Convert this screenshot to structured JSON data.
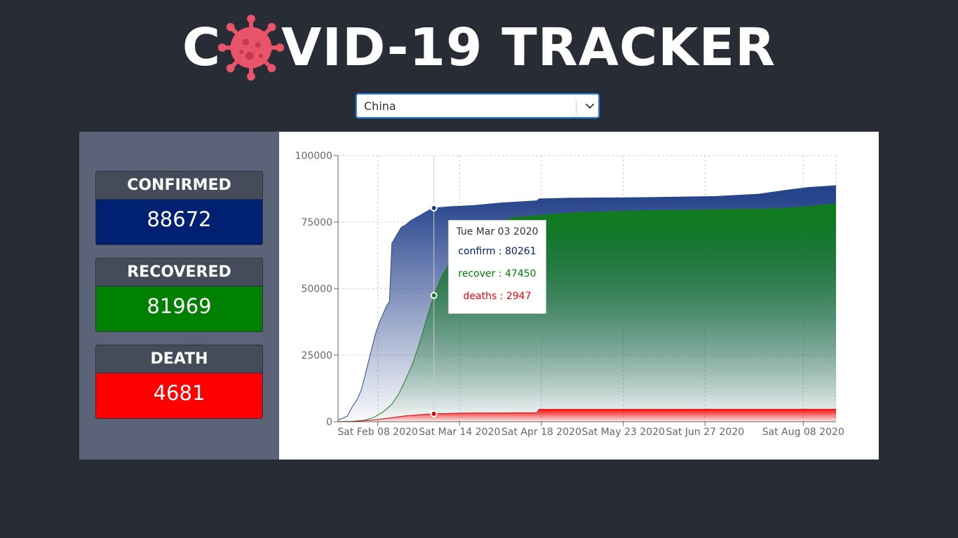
{
  "header": {
    "title_prefix": "C",
    "title_suffix": "VID-19 TRACKER",
    "icon": "virus-icon"
  },
  "country_select": {
    "value": "China",
    "icon": "chevron-down-icon"
  },
  "stats": {
    "confirmed": {
      "label": "CONFIRMED",
      "value": "88672",
      "color": "#002171"
    },
    "recovered": {
      "label": "RECOVERED",
      "value": "81969",
      "color": "#008000"
    },
    "death": {
      "label": "DEATH",
      "value": "4681",
      "color": "#ff0000"
    }
  },
  "tooltip": {
    "date": "Tue Mar 03 2020",
    "confirm": "confirm : 80261",
    "recover": "recover : 47450",
    "deaths": "deaths : 2947"
  },
  "chart_data": {
    "type": "area",
    "x_ticks": [
      "Sat Feb 08 2020",
      "Sat Mar 14 2020",
      "Sat Apr 18 2020",
      "Sat May 23 2020",
      "Sat Jun 27 2020",
      "Sat Aug 08 2020"
    ],
    "y_ticks": [
      "0",
      "25000",
      "50000",
      "75000",
      "100000"
    ],
    "ylim": [
      0,
      100000
    ],
    "xlim": [
      "2020-01-22",
      "2020-08-22"
    ],
    "grid": true,
    "series": [
      {
        "key": "confirm",
        "color": "#2c4a8c",
        "points": [
          [
            "2020-01-22",
            548
          ],
          [
            "2020-01-26",
            2118
          ],
          [
            "2020-01-28",
            5509
          ],
          [
            "2020-01-30",
            8000
          ],
          [
            "2020-02-01",
            12000
          ],
          [
            "2020-02-03",
            19000
          ],
          [
            "2020-02-05",
            26000
          ],
          [
            "2020-02-07",
            33000
          ],
          [
            "2020-02-09",
            38000
          ],
          [
            "2020-02-11",
            42000
          ],
          [
            "2020-02-12",
            44000
          ],
          [
            "2020-02-13",
            45000
          ],
          [
            "2020-02-14",
            67000
          ],
          [
            "2020-02-16",
            70000
          ],
          [
            "2020-02-18",
            73000
          ],
          [
            "2020-02-20",
            74000
          ],
          [
            "2020-02-22",
            75500
          ],
          [
            "2020-02-24",
            76500
          ],
          [
            "2020-02-26",
            77500
          ],
          [
            "2020-02-28",
            78500
          ],
          [
            "2020-03-01",
            79500
          ],
          [
            "2020-03-03",
            80261
          ],
          [
            "2020-03-10",
            80800
          ],
          [
            "2020-03-20",
            81200
          ],
          [
            "2020-04-01",
            82200
          ],
          [
            "2020-04-16",
            83000
          ],
          [
            "2020-04-17",
            83700
          ],
          [
            "2020-05-01",
            84000
          ],
          [
            "2020-06-01",
            84200
          ],
          [
            "2020-07-01",
            84600
          ],
          [
            "2020-07-20",
            85500
          ],
          [
            "2020-08-01",
            87000
          ],
          [
            "2020-08-10",
            88000
          ],
          [
            "2020-08-22",
            88672
          ]
        ]
      },
      {
        "key": "recover",
        "color": "#1f7a1f",
        "points": [
          [
            "2020-01-22",
            28
          ],
          [
            "2020-01-28",
            150
          ],
          [
            "2020-02-02",
            500
          ],
          [
            "2020-02-06",
            1500
          ],
          [
            "2020-02-10",
            3500
          ],
          [
            "2020-02-14",
            6500
          ],
          [
            "2020-02-17",
            10500
          ],
          [
            "2020-02-20",
            16000
          ],
          [
            "2020-02-23",
            22000
          ],
          [
            "2020-02-26",
            30000
          ],
          [
            "2020-02-29",
            39000
          ],
          [
            "2020-03-03",
            47450
          ],
          [
            "2020-03-06",
            54000
          ],
          [
            "2020-03-10",
            60000
          ],
          [
            "2020-03-14",
            64000
          ],
          [
            "2020-03-20",
            70000
          ],
          [
            "2020-03-27",
            74000
          ],
          [
            "2020-04-05",
            76500
          ],
          [
            "2020-04-16",
            77500
          ],
          [
            "2020-05-01",
            78500
          ],
          [
            "2020-06-01",
            79300
          ],
          [
            "2020-07-01",
            79600
          ],
          [
            "2020-07-25",
            80000
          ],
          [
            "2020-08-10",
            80800
          ],
          [
            "2020-08-22",
            81969
          ]
        ]
      },
      {
        "key": "deaths",
        "color": "#e00000",
        "points": [
          [
            "2020-01-22",
            17
          ],
          [
            "2020-01-30",
            170
          ],
          [
            "2020-02-06",
            630
          ],
          [
            "2020-02-13",
            1400
          ],
          [
            "2020-02-20",
            2200
          ],
          [
            "2020-02-27",
            2700
          ],
          [
            "2020-03-03",
            2947
          ],
          [
            "2020-03-15",
            3200
          ],
          [
            "2020-04-01",
            3300
          ],
          [
            "2020-04-16",
            3350
          ],
          [
            "2020-04-17",
            4630
          ],
          [
            "2020-05-15",
            4633
          ],
          [
            "2020-08-22",
            4681
          ]
        ]
      }
    ],
    "hover": {
      "date": "2020-03-03",
      "confirm": 80261,
      "recover": 47450,
      "deaths": 2947
    }
  }
}
